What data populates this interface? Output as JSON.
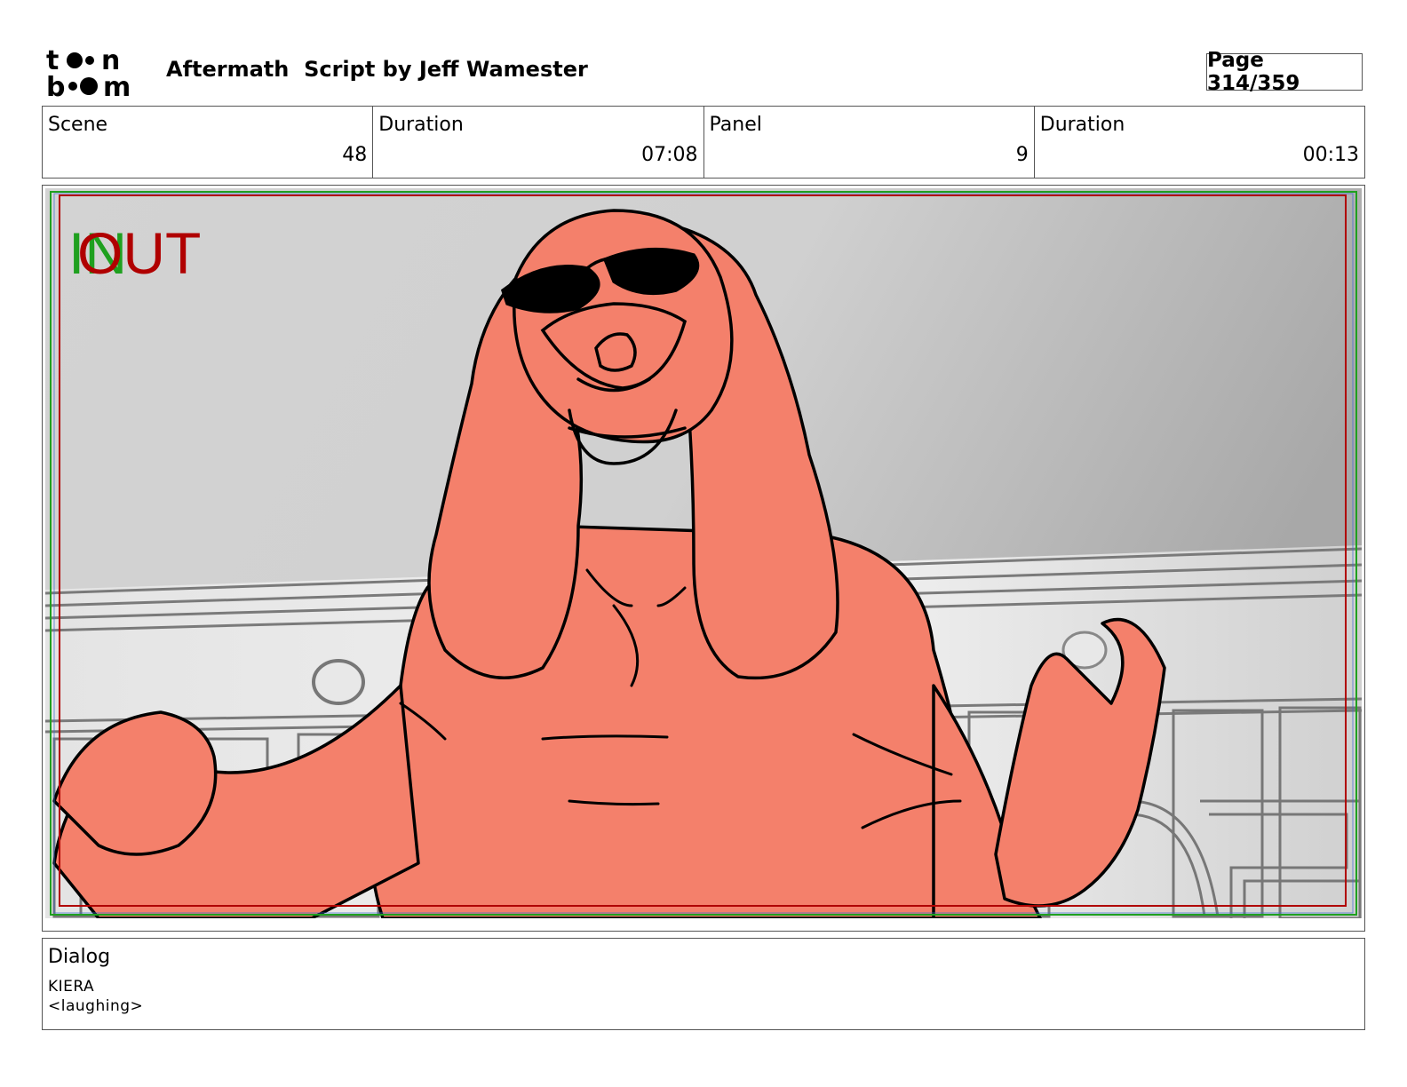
{
  "header": {
    "logo_text": "toon boom",
    "title": "Aftermath  Script by Jeff Wamester",
    "page": "Page 314/359"
  },
  "info": {
    "scene_label": "Scene",
    "scene_value": "48",
    "scene_duration_label": "Duration",
    "scene_duration_value": "07:08",
    "panel_label": "Panel",
    "panel_value": "9",
    "panel_duration_label": "Duration",
    "panel_duration_value": "00:13"
  },
  "panel": {
    "in_marker": "IN",
    "out_marker": "OUT",
    "colors": {
      "in": "#1fa01f",
      "out": "#b00000",
      "character_fill": "#f4806b",
      "outline": "#000000"
    }
  },
  "dialog": {
    "title": "Dialog",
    "character": "KIERA",
    "line": "<laughing>"
  }
}
